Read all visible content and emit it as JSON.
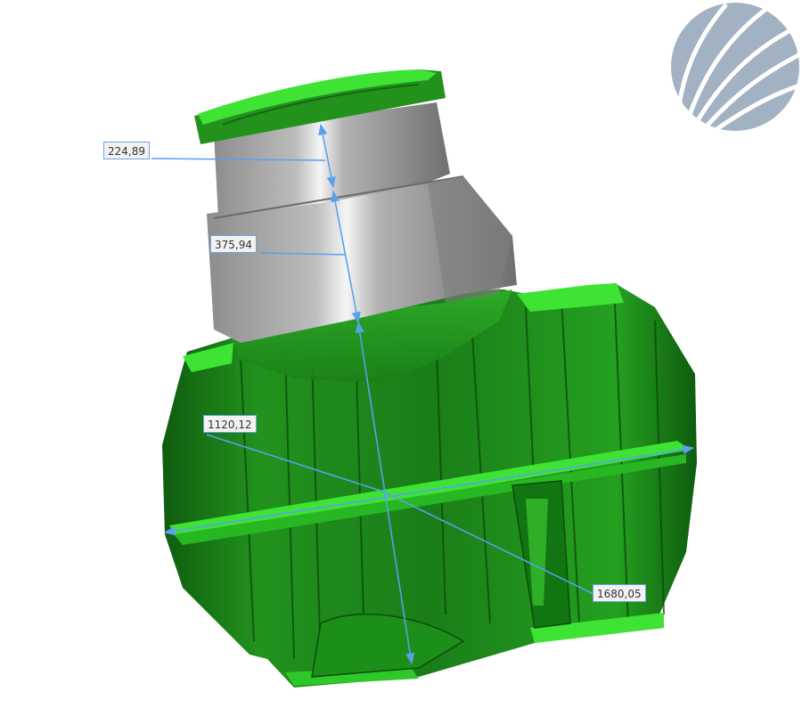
{
  "dimensions": {
    "upper_riser_height": "224,89",
    "lower_riser_height": "375,94",
    "tank_diameter": "1120,12",
    "tank_length": "1680,05"
  },
  "colors": {
    "tank_body": "#1e8a1c",
    "tank_highlight": "#2fc82a",
    "riser_gray": "#9a9a9a",
    "dimension_line": "#5aa0ef",
    "logo": "#a3b2c3"
  },
  "logo": {
    "icon": "stylized-sun-rays-logo"
  }
}
